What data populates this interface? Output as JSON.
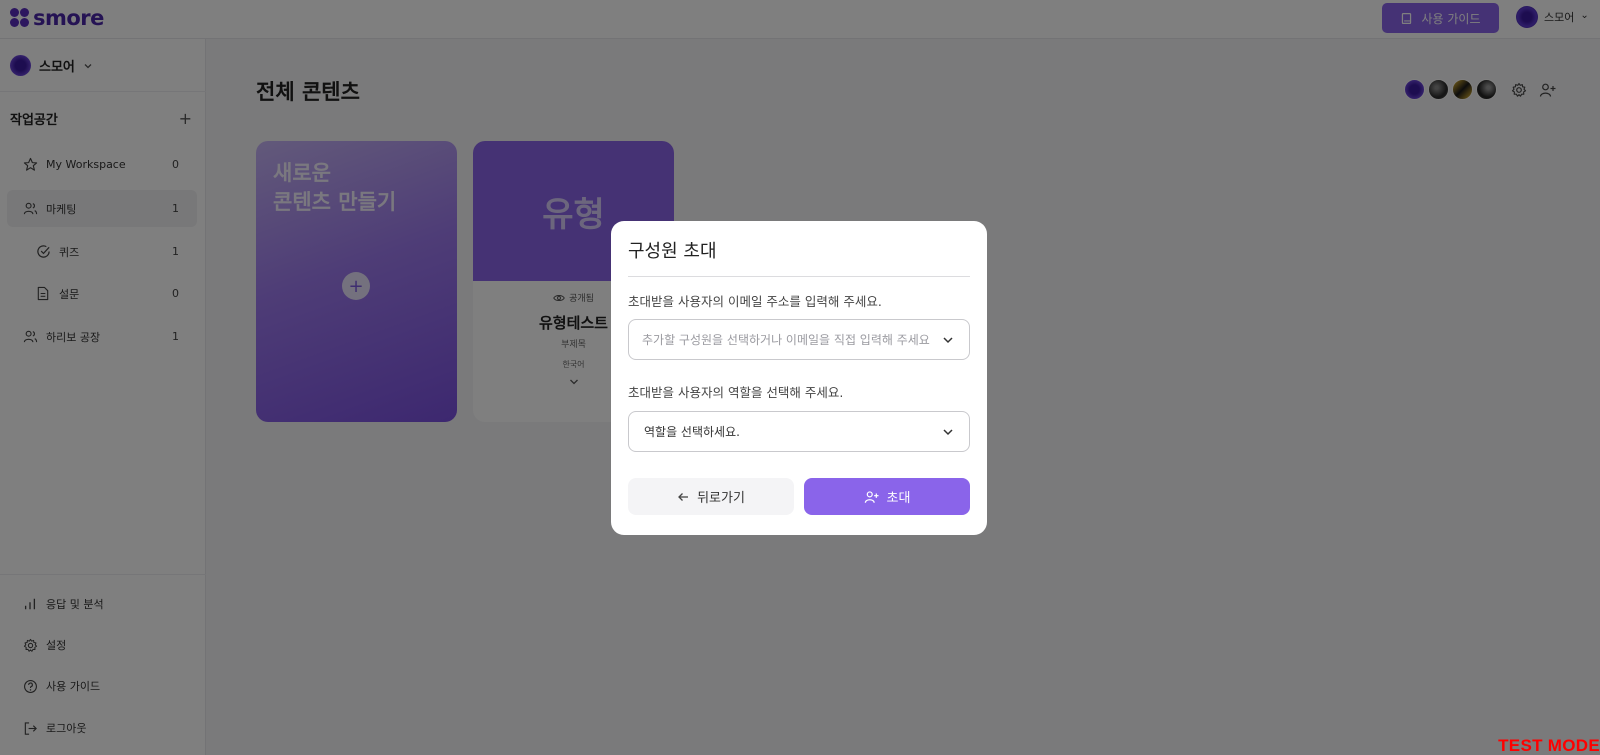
{
  "brand": {
    "logo_text": "smore",
    "accent": "#8a64ea",
    "logo_color": "#4b27a8"
  },
  "topbar": {
    "guide_button": "사용 가이드",
    "user_name": "스모어",
    "user_caret": "⌄"
  },
  "sidebar": {
    "workspace_switch": "스모어",
    "section_title": "작업공간",
    "add_icon": "plus-icon",
    "items": [
      {
        "label": "My Workspace",
        "count": "0",
        "icon": "star-icon"
      },
      {
        "label": "마케팅",
        "count": "1",
        "icon": "users-icon"
      },
      {
        "label": "퀴즈",
        "count": "1",
        "icon": "check-circle-icon"
      },
      {
        "label": "설문",
        "count": "0",
        "icon": "document-icon"
      },
      {
        "label": "하리보 공장",
        "count": "1",
        "icon": "users-icon"
      }
    ],
    "bottom": [
      {
        "label": "응답 및 분석",
        "icon": "bar-chart-icon"
      },
      {
        "label": "설정",
        "icon": "gear-icon"
      },
      {
        "label": "사용 가이드",
        "icon": "help-circle-icon"
      },
      {
        "label": "로그아웃",
        "icon": "logout-icon"
      }
    ]
  },
  "main": {
    "title": "전체 콘텐츠",
    "new_card_line1": "새로운",
    "new_card_line2": "콘텐츠 만들기",
    "content_card": {
      "thumb_text": "유형",
      "visibility": "공개됨",
      "name": "유형테스트",
      "subtitle": "부제목",
      "language": "한국어"
    }
  },
  "modal": {
    "title": "구성원 초대",
    "email_label": "초대받을 사용자의 이메일 주소를 입력해 주세요.",
    "email_placeholder": "추가할 구성원을 선택하거나 이메일을 직접 입력해 주세요",
    "role_label": "초대받을 사용자의 역할을 선택해 주세요.",
    "role_value": "역할을 선택하세요.",
    "back_button": "뒤로가기",
    "invite_button": "초대"
  },
  "watermark": "TEST MODE"
}
